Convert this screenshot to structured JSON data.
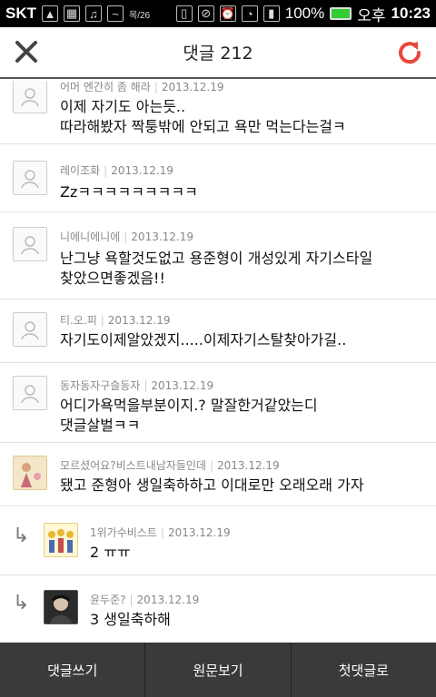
{
  "statusbar": {
    "carrier": "SKT",
    "date_badge": "목/26",
    "battery": "100%",
    "ampm": "오후",
    "time": "10:23"
  },
  "header": {
    "title": "댓글 212",
    "accent_color": "#e8483a"
  },
  "comments": [
    {
      "author": "어머 엔간히 좀 해라",
      "date": "2013.12.19",
      "lines": [
        "이제 자기도 아는듯..",
        "따라해봤자 짝퉁밖에 안되고 욕만 먹는다는걸ㅋ"
      ]
    },
    {
      "author": "레이조화",
      "date": "2013.12.19",
      "lines": [
        "Zzㅋㅋㅋㅋㅋㅋㅋㅋㅋ"
      ]
    },
    {
      "author": "니에니에니에",
      "date": "2013.12.19",
      "lines": [
        "난그냥 욕할것도없고 용준형이 개성있게 자기스타일",
        "찾았으면좋겠음!!"
      ]
    },
    {
      "author": "티.오.피",
      "date": "2013.12.19",
      "lines": [
        "자기도이제알았겠지.....이제자기스탈찾아가길.."
      ]
    },
    {
      "author": "동자동자구슬동자",
      "date": "2013.12.19",
      "lines": [
        "어디가욕먹을부분이지.? 말잘한거같았는디",
        "댓글살벌ㅋㅋ"
      ]
    },
    {
      "author": "모르셨어요?비스트내남자들인데",
      "date": "2013.12.19",
      "lines": [
        "됐고 준형아 생일축하하고 이대로만 오래오래 가자"
      ]
    }
  ],
  "replies": [
    {
      "author": "1위가수비스트",
      "date": "2013.12.19",
      "text": "2 ㅠㅠ"
    },
    {
      "author": "윤두준?",
      "date": "2013.12.19",
      "text": "3 생일축하해"
    }
  ],
  "bottombar": {
    "write": "댓글쓰기",
    "original": "원문보기",
    "first": "첫댓글로"
  }
}
